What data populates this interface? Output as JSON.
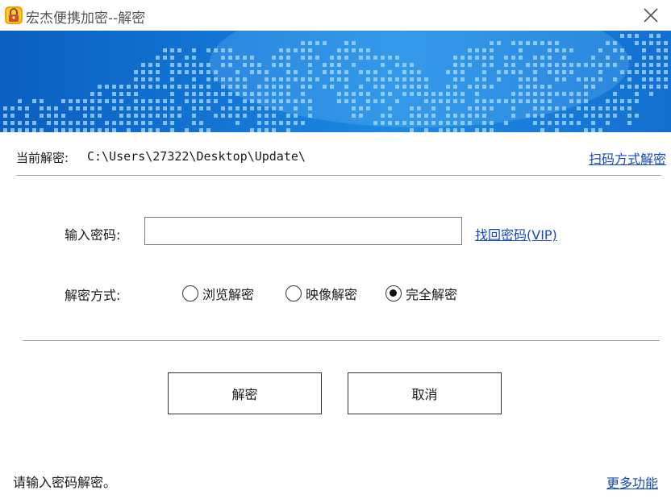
{
  "window": {
    "title": "宏杰便携加密--解密"
  },
  "current": {
    "label": "当前解密:",
    "path": "C:\\Users\\27322\\Desktop\\Update\\",
    "scan_link": "扫码方式解密"
  },
  "password": {
    "label": "输入密码:",
    "value": "",
    "placeholder": "",
    "recover_link": "找回密码(VIP)"
  },
  "mode": {
    "label": "解密方式:",
    "options": [
      {
        "label": "浏览解密",
        "checked": false
      },
      {
        "label": "映像解密",
        "checked": false
      },
      {
        "label": "完全解密",
        "checked": true
      }
    ]
  },
  "buttons": {
    "decrypt_label": "解密",
    "cancel_label": "取消"
  },
  "footer": {
    "status": "请输入密码解密。",
    "more_link": "更多功能"
  },
  "icons": {
    "app": "lock-icon",
    "close": "close-icon"
  },
  "colors": {
    "link": "#1648c0",
    "banner": "#1476d6",
    "app_icon": "#e08a00"
  }
}
